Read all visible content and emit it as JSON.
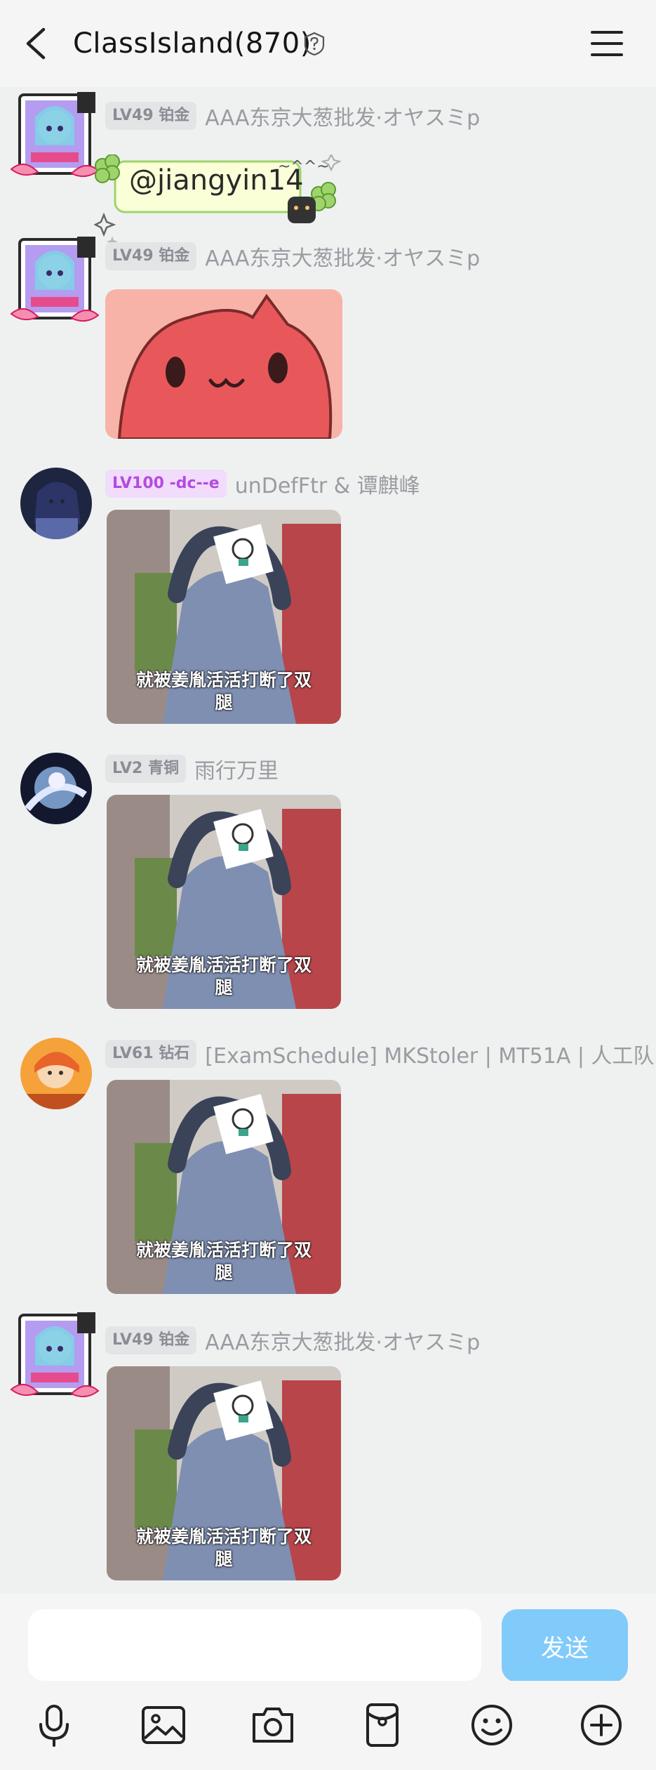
{
  "header": {
    "title": "ClassIsland(870)",
    "icons": [
      "back-arrow-icon",
      "question-badge-icon",
      "hamburger-menu-icon"
    ]
  },
  "messages": [
    {
      "badge": "LV49 铂金",
      "name": "AAA东京大葱批发·オヤスミp",
      "type": "mention-sticker",
      "text": "@jiangyin14"
    },
    {
      "badge": "LV49 铂金",
      "name": "AAA东京大葱批发·オヤスミp",
      "type": "image"
    },
    {
      "badge": "LV100 -dc--e",
      "name": "unDefFtr & 谭麒峰",
      "type": "image",
      "caption_line1": "就被姜胤活活打断了双",
      "caption_line2": "腿"
    },
    {
      "badge": "LV2 青铜",
      "name": "雨行万里",
      "type": "image",
      "caption_line1": "就被姜胤活活打断了双",
      "caption_line2": "腿"
    },
    {
      "badge": "LV61 钻石",
      "name": "[ExamSchedule] MKStoler | MT51A | 人工队",
      "type": "image",
      "caption_line1": "就被姜胤活活打断了双",
      "caption_line2": "腿"
    },
    {
      "badge": "LV49 铂金",
      "name": "AAA东京大葱批发·オヤスミp",
      "type": "image",
      "caption_line1": "就被姜胤活活打断了双",
      "caption_line2": "腿"
    }
  ],
  "composer": {
    "placeholder": "",
    "send_label": "发送"
  },
  "toolbar": {
    "icons": [
      "microphone-icon",
      "image-icon",
      "camera-icon",
      "red-packet-icon",
      "emoji-icon",
      "plus-icon"
    ]
  },
  "colors": {
    "background": "#eef1f0",
    "send_button": "#80cbfa",
    "purple_badge": "#b44ae0"
  }
}
